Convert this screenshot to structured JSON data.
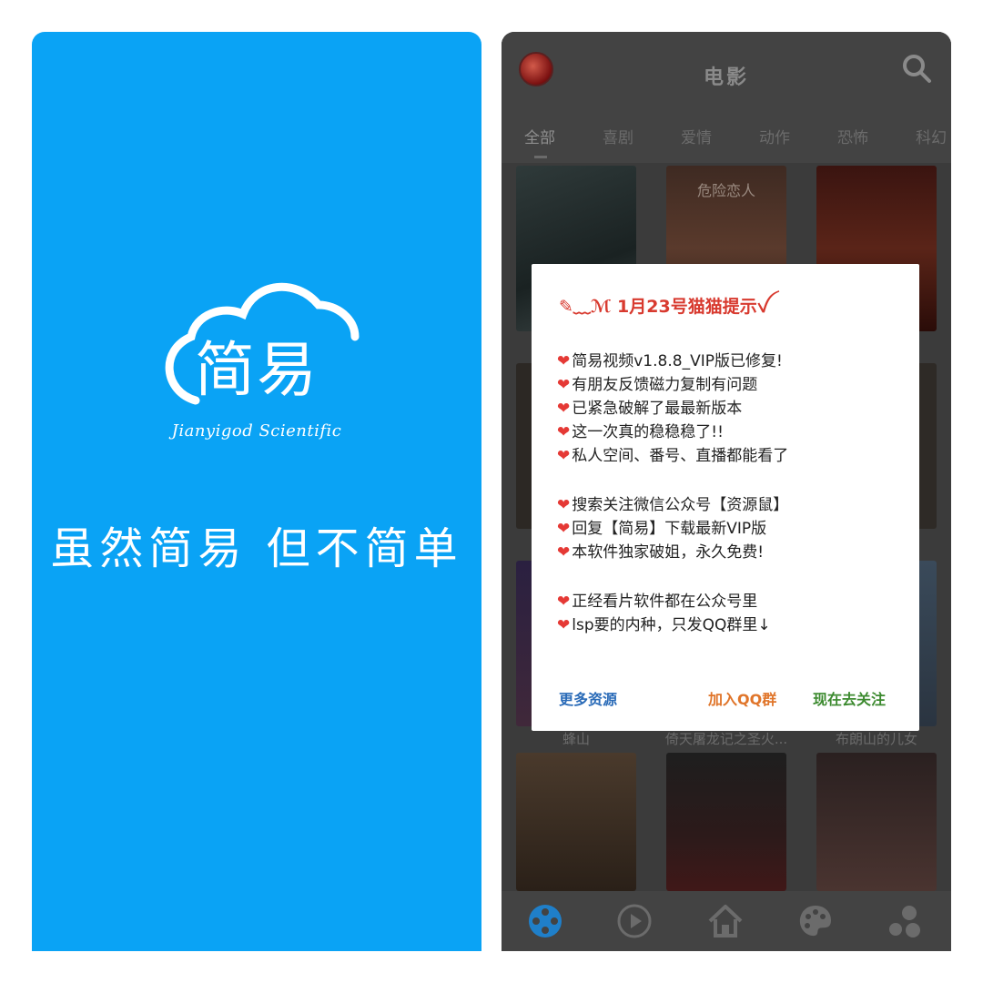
{
  "splash": {
    "logo_text": "简易",
    "signature": "Jianyigod Scientific",
    "slogan": "虽然简易 但不简单",
    "background": "#0aa3f5"
  },
  "app": {
    "title": "电影",
    "search_icon": "search-icon",
    "tabs": [
      "全部",
      "喜剧",
      "爱情",
      "动作",
      "恐怖",
      "科幻"
    ],
    "active_tab": "全部",
    "movies": [
      {
        "caption": ""
      },
      {
        "caption": "危险恋人"
      },
      {
        "caption": ""
      },
      {
        "caption": "蜂山"
      },
      {
        "caption": "倚天屠龙记之圣火..."
      },
      {
        "caption": "布朗山的儿女"
      }
    ],
    "bottom_nav": [
      "film-reel-icon",
      "play-circle-icon",
      "home-icon",
      "palette-icon",
      "dots-icon"
    ]
  },
  "dialog": {
    "title": "✎﹏ℳ 1月23号猫猫提示ꪜ",
    "lines": [
      "简易视频v1.8.8_VIP版已修复!",
      "有朋友反馈磁力复制有问题",
      "已紧急破解了最最新版本",
      "这一次真的稳稳稳了!!",
      "私人空间、番号、直播都能看了",
      "",
      "搜索关注微信公众号【资源鼠】",
      "回复【简易】下载最新VIP版",
      "本软件独家破姐，永久免费!",
      "",
      "正经看片软件都在公众号里",
      "lsp要的内种，只发QQ群里↓"
    ],
    "buttons": {
      "more": "更多资源",
      "qq": "加入QQ群",
      "follow": "现在去关注"
    },
    "colors": {
      "more": "#2a6bb8",
      "qq": "#e0752a",
      "follow": "#3c8a2f",
      "title": "#d83a2f",
      "heart": "#e53935"
    }
  }
}
